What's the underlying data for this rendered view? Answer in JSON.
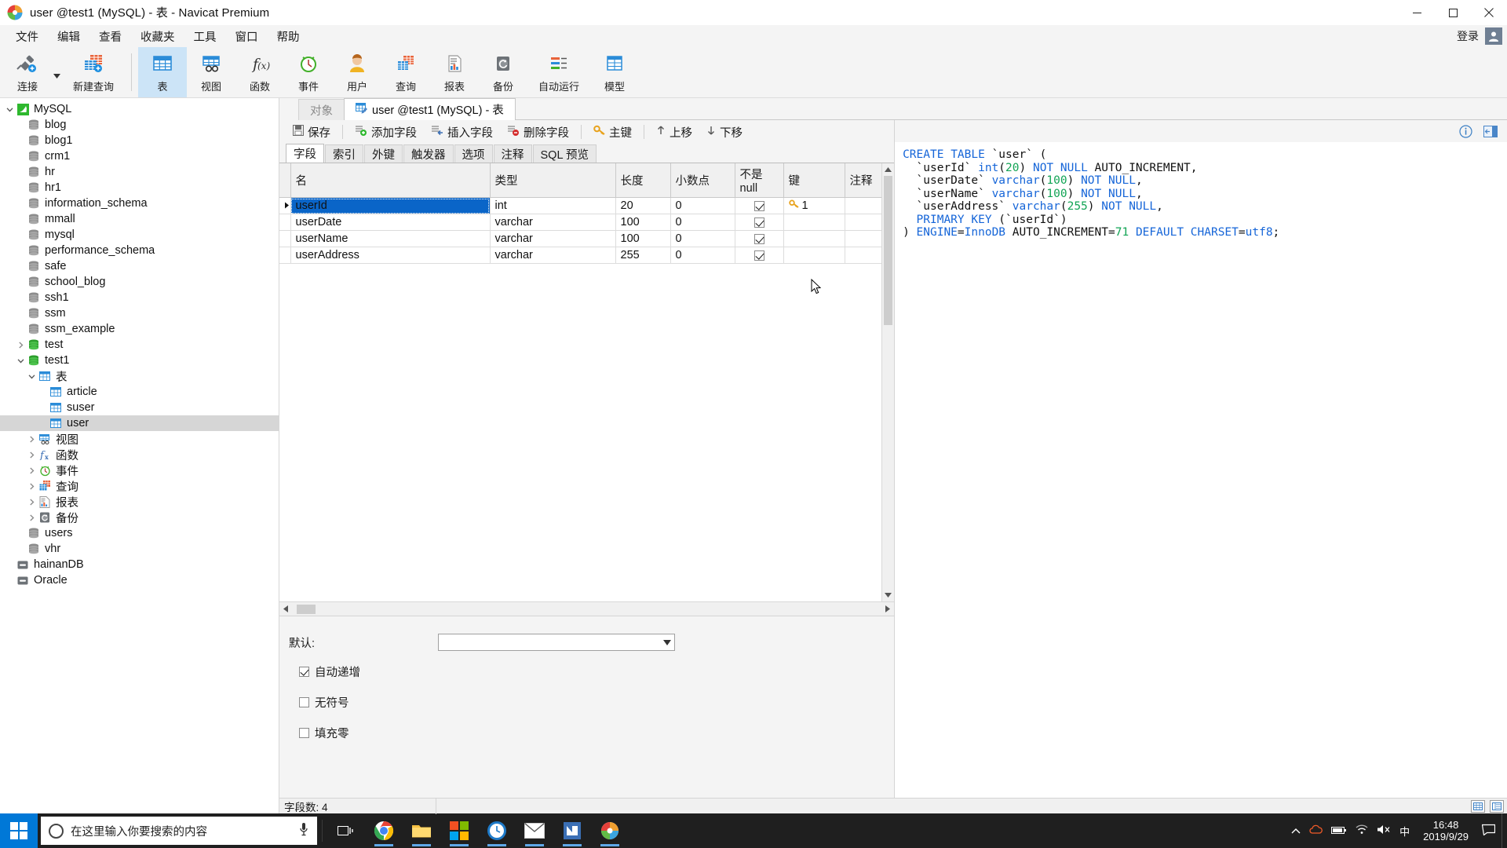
{
  "window": {
    "title": "user @test1 (MySQL) - 表 - Navicat Premium",
    "minimize": "minimize-icon",
    "maximize": "maximize-icon",
    "close": "close-icon"
  },
  "menubar": {
    "items": [
      "文件",
      "编辑",
      "查看",
      "收藏夹",
      "工具",
      "窗口",
      "帮助"
    ],
    "login_label": "登录"
  },
  "toolbar": {
    "items": [
      {
        "label": "连接",
        "icon": "connection-icon"
      },
      {
        "label": "新建查询",
        "icon": "new-query-icon"
      },
      {
        "label": "表",
        "icon": "table-icon",
        "active": true
      },
      {
        "label": "视图",
        "icon": "view-icon"
      },
      {
        "label": "函数",
        "icon": "function-icon"
      },
      {
        "label": "事件",
        "icon": "event-icon"
      },
      {
        "label": "用户",
        "icon": "user-icon"
      },
      {
        "label": "查询",
        "icon": "query-icon"
      },
      {
        "label": "报表",
        "icon": "report-icon"
      },
      {
        "label": "备份",
        "icon": "backup-icon"
      },
      {
        "label": "自动运行",
        "icon": "automation-icon"
      },
      {
        "label": "模型",
        "icon": "model-icon"
      }
    ]
  },
  "sidebar": {
    "nodes": [
      {
        "label": "MySQL",
        "indent": 0,
        "icon": "mysql-icon",
        "arrow": "down"
      },
      {
        "label": "blog",
        "indent": 1,
        "icon": "db-gray-icon",
        "arrow": "none"
      },
      {
        "label": "blog1",
        "indent": 1,
        "icon": "db-gray-icon",
        "arrow": "none"
      },
      {
        "label": "crm1",
        "indent": 1,
        "icon": "db-gray-icon",
        "arrow": "none"
      },
      {
        "label": "hr",
        "indent": 1,
        "icon": "db-gray-icon",
        "arrow": "none"
      },
      {
        "label": "hr1",
        "indent": 1,
        "icon": "db-gray-icon",
        "arrow": "none"
      },
      {
        "label": "information_schema",
        "indent": 1,
        "icon": "db-gray-icon",
        "arrow": "none"
      },
      {
        "label": "mmall",
        "indent": 1,
        "icon": "db-gray-icon",
        "arrow": "none"
      },
      {
        "label": "mysql",
        "indent": 1,
        "icon": "db-gray-icon",
        "arrow": "none"
      },
      {
        "label": "performance_schema",
        "indent": 1,
        "icon": "db-gray-icon",
        "arrow": "none"
      },
      {
        "label": "safe",
        "indent": 1,
        "icon": "db-gray-icon",
        "arrow": "none"
      },
      {
        "label": "school_blog",
        "indent": 1,
        "icon": "db-gray-icon",
        "arrow": "none"
      },
      {
        "label": "ssh1",
        "indent": 1,
        "icon": "db-gray-icon",
        "arrow": "none"
      },
      {
        "label": "ssm",
        "indent": 1,
        "icon": "db-gray-icon",
        "arrow": "none"
      },
      {
        "label": "ssm_example",
        "indent": 1,
        "icon": "db-gray-icon",
        "arrow": "none"
      },
      {
        "label": "test",
        "indent": 1,
        "icon": "db-green-icon",
        "arrow": "right"
      },
      {
        "label": "test1",
        "indent": 1,
        "icon": "db-green-icon",
        "arrow": "down"
      },
      {
        "label": "表",
        "indent": 2,
        "icon": "table-blue-icon",
        "arrow": "down"
      },
      {
        "label": "article",
        "indent": 3,
        "icon": "table-blue-icon",
        "arrow": "none"
      },
      {
        "label": "suser",
        "indent": 3,
        "icon": "table-blue-icon",
        "arrow": "none"
      },
      {
        "label": "user",
        "indent": 3,
        "icon": "table-blue-icon",
        "arrow": "none",
        "selected": true
      },
      {
        "label": "视图",
        "indent": 2,
        "icon": "view-icon",
        "arrow": "right"
      },
      {
        "label": "函数",
        "indent": 2,
        "icon": "function-icon",
        "arrow": "right"
      },
      {
        "label": "事件",
        "indent": 2,
        "icon": "event-icon",
        "arrow": "right"
      },
      {
        "label": "查询",
        "indent": 2,
        "icon": "query-icon",
        "arrow": "right"
      },
      {
        "label": "报表",
        "indent": 2,
        "icon": "report-icon",
        "arrow": "right"
      },
      {
        "label": "备份",
        "indent": 2,
        "icon": "backup-icon",
        "arrow": "right"
      },
      {
        "label": "users",
        "indent": 1,
        "icon": "db-gray-icon",
        "arrow": "none"
      },
      {
        "label": "vhr",
        "indent": 1,
        "icon": "db-gray-icon",
        "arrow": "none"
      },
      {
        "label": "hainanDB",
        "indent": 0,
        "icon": "conn-gray-icon",
        "arrow": "none"
      },
      {
        "label": "Oracle",
        "indent": 0,
        "icon": "conn-gray-icon",
        "arrow": "none"
      }
    ]
  },
  "tabs": [
    {
      "label": "对象",
      "active": false,
      "icon": ""
    },
    {
      "label": "user @test1 (MySQL) - 表",
      "active": true,
      "icon": "table-edit-icon"
    }
  ],
  "actions": [
    {
      "label": "保存",
      "icon": "save-icon"
    },
    {
      "label": "添加字段",
      "icon": "add-field-icon"
    },
    {
      "label": "插入字段",
      "icon": "insert-field-icon"
    },
    {
      "label": "删除字段",
      "icon": "delete-field-icon"
    },
    {
      "label": "主键",
      "icon": "primary-key-icon"
    },
    {
      "label": "上移",
      "icon": "move-up-icon"
    },
    {
      "label": "下移",
      "icon": "move-down-icon"
    }
  ],
  "subtabs": [
    {
      "label": "字段",
      "active": true
    },
    {
      "label": "索引",
      "active": false
    },
    {
      "label": "外键",
      "active": false
    },
    {
      "label": "触发器",
      "active": false
    },
    {
      "label": "选项",
      "active": false
    },
    {
      "label": "注释",
      "active": false
    },
    {
      "label": "SQL 预览",
      "active": false
    }
  ],
  "grid": {
    "columns": [
      "名",
      "类型",
      "长度",
      "小数点",
      "不是 null",
      "键",
      "注释"
    ],
    "rows": [
      {
        "name": "userId",
        "type": "int",
        "length": "20",
        "decimals": "0",
        "notnull": true,
        "key": "1",
        "comment": "",
        "selected": true
      },
      {
        "name": "userDate",
        "type": "varchar",
        "length": "100",
        "decimals": "0",
        "notnull": true,
        "key": "",
        "comment": "",
        "selected": false
      },
      {
        "name": "userName",
        "type": "varchar",
        "length": "100",
        "decimals": "0",
        "notnull": true,
        "key": "",
        "comment": "",
        "selected": false
      },
      {
        "name": "userAddress",
        "type": "varchar",
        "length": "255",
        "decimals": "0",
        "notnull": true,
        "key": "",
        "comment": "",
        "selected": false
      }
    ]
  },
  "properties": {
    "default_label": "默认:",
    "default_value": "",
    "checkboxes": [
      {
        "label": "自动递增",
        "checked": true
      },
      {
        "label": "无符号",
        "checked": false
      },
      {
        "label": "填充零",
        "checked": false
      }
    ]
  },
  "sql_panel": {
    "info_icon": "info-icon",
    "expand_icon": "expand-icon",
    "lines": [
      "CREATE TABLE `user` (",
      "  `userId` int(20) NOT NULL AUTO_INCREMENT,",
      "  `userDate` varchar(100) NOT NULL,",
      "  `userName` varchar(100) NOT NULL,",
      "  `userAddress` varchar(255) NOT NULL,",
      "  PRIMARY KEY (`userId`)",
      ") ENGINE=InnoDB AUTO_INCREMENT=71 DEFAULT CHARSET=utf8;"
    ]
  },
  "statusbar": {
    "field_count": "字段数: 4",
    "view_grid": "grid-view-icon",
    "view_form": "form-view-icon"
  },
  "taskbar": {
    "start": "start-icon",
    "search_placeholder": "在这里输入你要搜索的内容",
    "mic": "microphone-icon",
    "taskview": "task-view-icon",
    "apps": [
      {
        "name": "chrome-icon"
      },
      {
        "name": "file-explorer-icon"
      },
      {
        "name": "store-icon"
      },
      {
        "name": "clock-icon"
      },
      {
        "name": "mail-icon"
      },
      {
        "name": "navicat-icon"
      },
      {
        "name": "app-icon"
      }
    ],
    "tray": [
      "chevron-up-icon",
      "onedrive-icon",
      "battery-icon",
      "network-icon",
      "volume-icon",
      "ime-icon"
    ],
    "ime": "中",
    "time": "16:48",
    "date": "2019/9/29",
    "action_center": "notification-icon"
  },
  "colors": {
    "accent": "#0a65c8",
    "toolbar_active": "#cce4f7",
    "sql_keyword": "#1565d8",
    "sql_number": "#12a455",
    "selection": "#d6d6d6"
  }
}
